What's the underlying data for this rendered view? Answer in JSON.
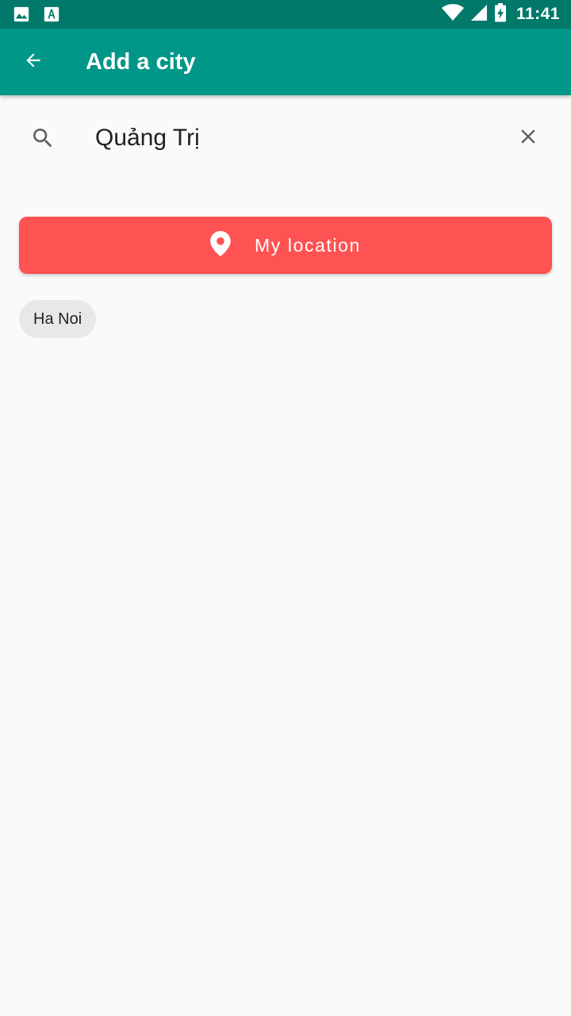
{
  "status_bar": {
    "time": "11:41",
    "icons": [
      "image-icon",
      "font-icon",
      "wifi-icon",
      "signal-icon",
      "battery-charging-icon"
    ]
  },
  "app_bar": {
    "title": "Add a city",
    "back_icon": "arrow-back-icon"
  },
  "search": {
    "value": "Quảng Trị",
    "search_icon": "search-icon",
    "clear_icon": "close-icon"
  },
  "location_button": {
    "label": "My location",
    "icon": "map-pin-icon",
    "color": "#ff5252"
  },
  "chips": [
    {
      "label": "Ha Noi"
    }
  ],
  "colors": {
    "status_bar": "#00796b",
    "app_bar": "#009688",
    "background": "#fafafa"
  }
}
